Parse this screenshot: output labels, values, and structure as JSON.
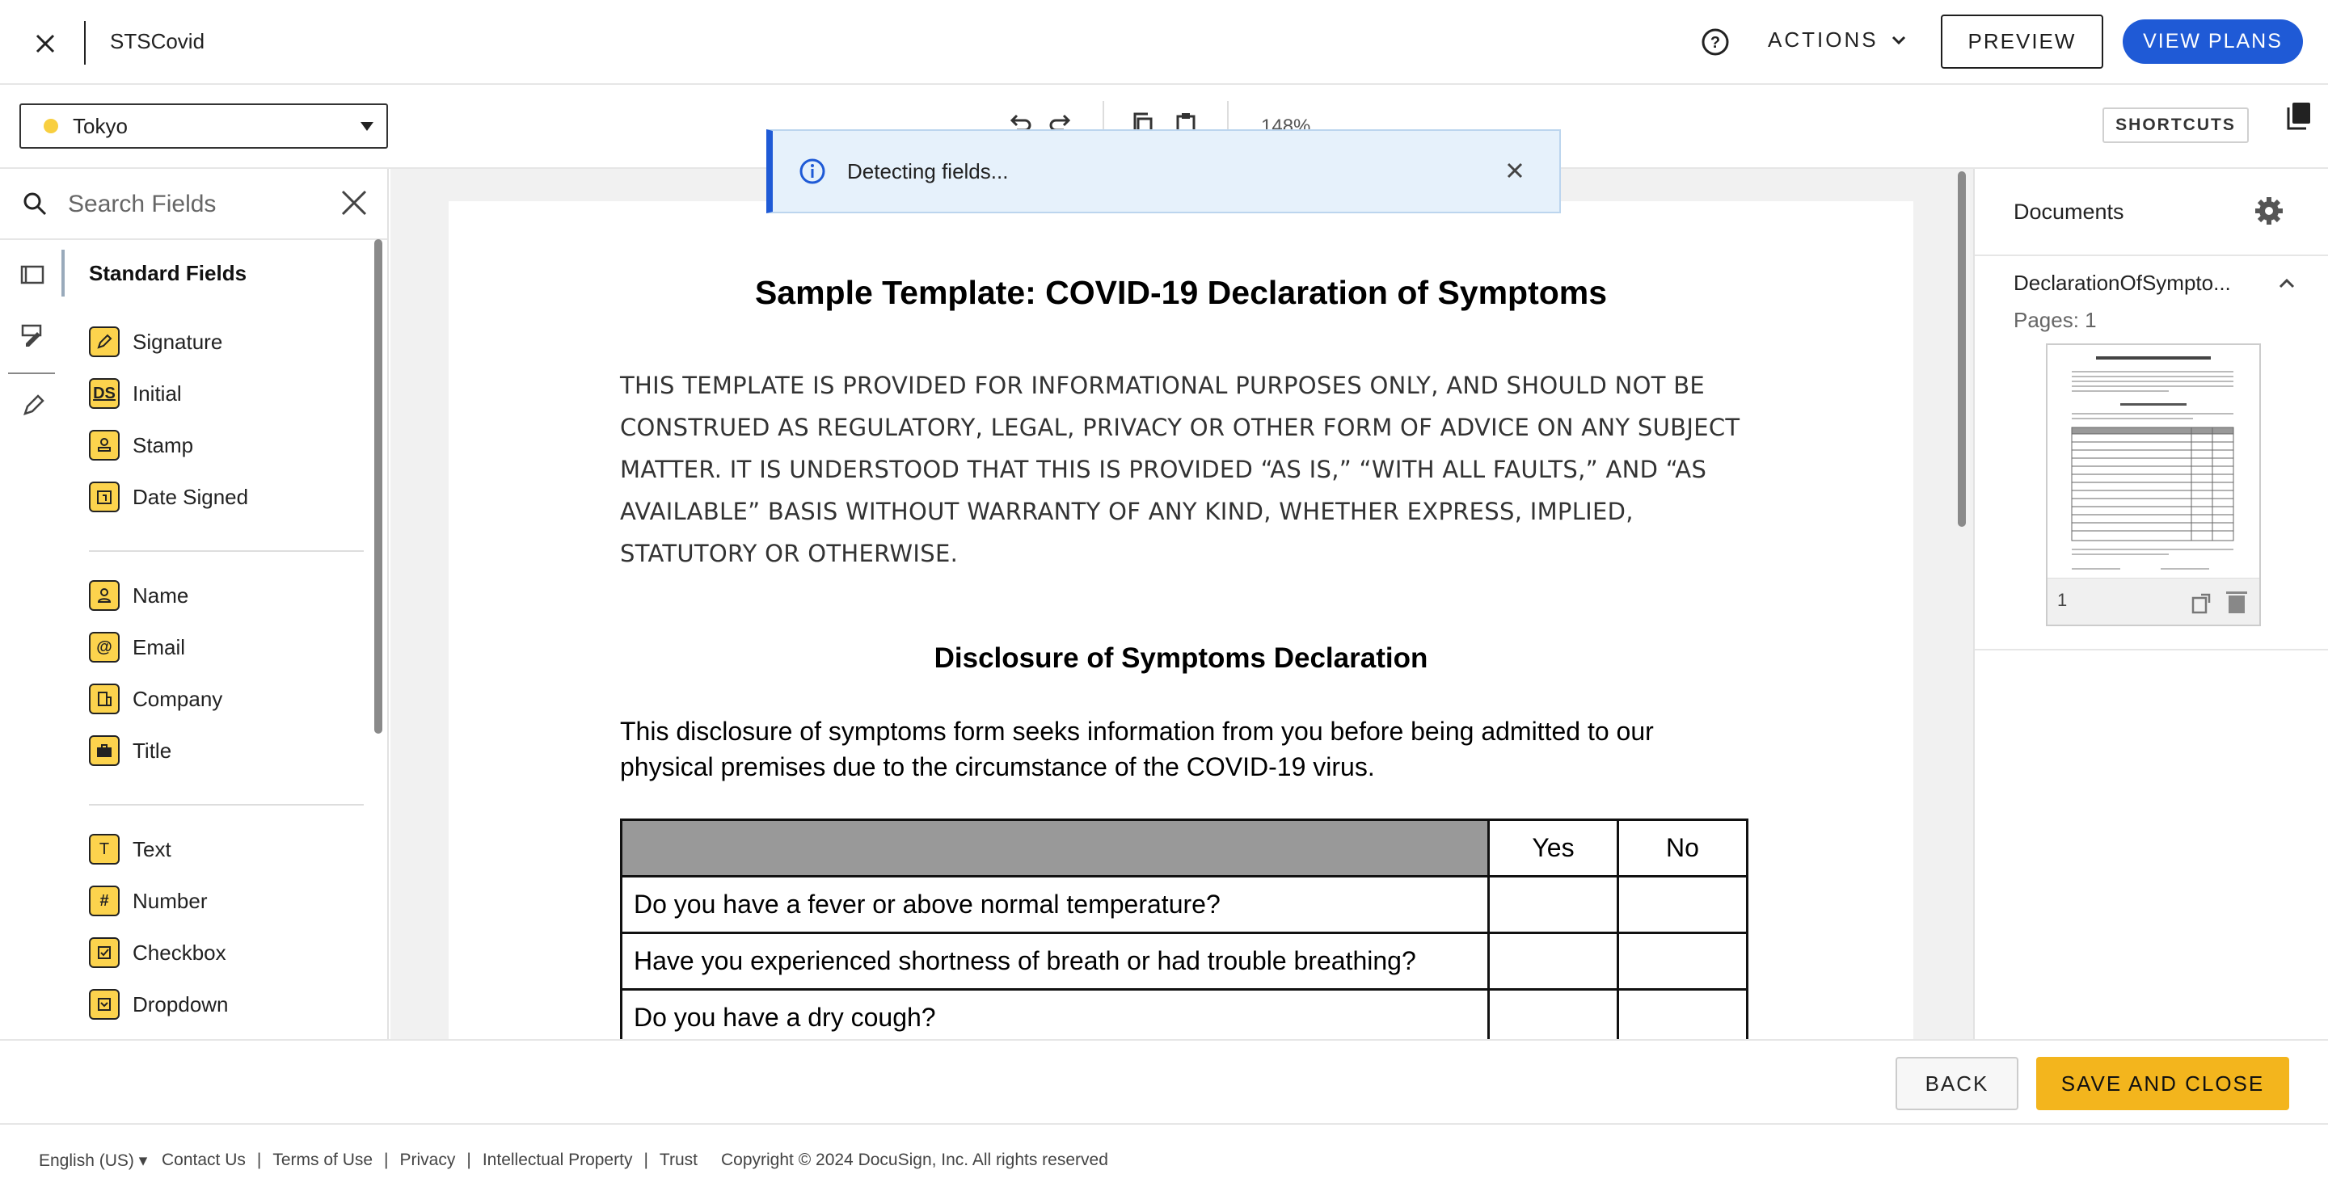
{
  "header": {
    "title": "STSCovid",
    "actions_label": "ACTIONS",
    "preview_label": "PREVIEW",
    "view_plans_label": "VIEW PLANS"
  },
  "toolbar": {
    "recipient": "Tokyo",
    "zoom": "148%",
    "shortcuts_label": "SHORTCUTS"
  },
  "search": {
    "placeholder": "Search Fields"
  },
  "fields": {
    "section_title": "Standard Fields",
    "group1": [
      "Signature",
      "Initial",
      "Stamp",
      "Date Signed"
    ],
    "group2": [
      "Name",
      "Email",
      "Company",
      "Title"
    ],
    "group3": [
      "Text",
      "Number",
      "Checkbox",
      "Dropdown"
    ],
    "icons": {
      "initial": "DS",
      "text": "T",
      "number": "#",
      "email": "@"
    }
  },
  "toast": {
    "message": "Detecting fields..."
  },
  "document": {
    "title": "Sample Template: COVID-19 Declaration of Symptoms",
    "disclaimer": "THIS TEMPLATE IS PROVIDED FOR INFORMATIONAL PURPOSES ONLY, AND SHOULD NOT BE CONSTRUED AS REGULATORY, LEGAL, PRIVACY OR OTHER FORM OF ADVICE ON ANY SUBJECT MATTER. IT IS UNDERSTOOD THAT THIS IS PROVIDED “AS IS,” “WITH ALL FAULTS,” AND “AS AVAILABLE” BASIS WITHOUT WARRANTY OF ANY KIND, WHETHER EXPRESS, IMPLIED, STATUTORY OR OTHERWISE.",
    "subtitle": "Disclosure of Symptoms Declaration",
    "intro": "This disclosure of symptoms form seeks information from you before being admitted to our physical premises due to the circumstance of the COVID-19 virus.",
    "table": {
      "yes": "Yes",
      "no": "No",
      "questions": [
        "Do you have a fever or above normal temperature?",
        "Have you experienced shortness of breath or had trouble breathing?",
        "Do you have a dry cough?"
      ]
    }
  },
  "documents_panel": {
    "title": "Documents",
    "doc_name": "DeclarationOfSympto...",
    "pages": "Pages: 1",
    "thumb_page": "1"
  },
  "bottom_actions": {
    "back_label": "BACK",
    "save_label": "SAVE AND CLOSE"
  },
  "footer": {
    "language": "English (US)",
    "links": [
      "Contact Us",
      "Terms of Use",
      "Privacy",
      "Intellectual Property",
      "Trust"
    ],
    "copyright": "Copyright © 2024 DocuSign, Inc. All rights reserved"
  },
  "colors": {
    "accent": "#1f5ad6",
    "field_icon": "#fcd34d",
    "save": "#f3b51d",
    "recipient_dot": "#f8cf40"
  }
}
